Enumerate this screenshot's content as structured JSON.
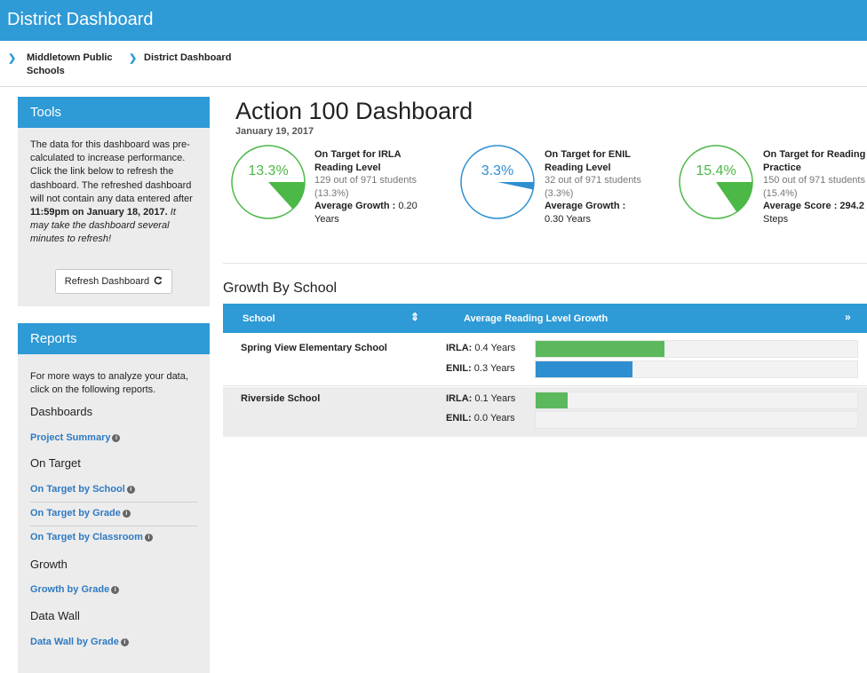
{
  "app_title": "District Dashboard",
  "breadcrumb": {
    "items": [
      {
        "line1": "Middletown Public",
        "line2": "Schools"
      },
      {
        "line1": "District Dashboard",
        "line2": ""
      }
    ]
  },
  "tools": {
    "title": "Tools",
    "text_line1": "The data for this dashboard was pre-",
    "text_line2": "calculated to increase performance.",
    "text_line3": "Click the link below to refresh the",
    "text_line4": "dashboard. The refreshed dashboard",
    "text_line5": "will not contain any data entered after",
    "text_bold": "11:59pm on January 18, 2017.",
    "text_italic_a": " It",
    "text_italic_b": "may take the dashboard several",
    "text_italic_c": "minutes to refresh!",
    "refresh_label": "Refresh Dashboard",
    "refresh_icon": "refresh-icon"
  },
  "reports": {
    "title": "Reports",
    "intro_line1": "For more ways to analyze your data,",
    "intro_line2": "click on the following reports.",
    "groups": [
      {
        "heading": "Dashboards",
        "links": [
          "Project Summary"
        ]
      },
      {
        "heading": "On Target",
        "links": [
          "On Target by School",
          "On Target by Grade",
          "On Target by Classroom"
        ]
      },
      {
        "heading": "Growth",
        "links": [
          "Growth by Grade"
        ]
      },
      {
        "heading": "Data Wall",
        "links": [
          "Data Wall by Grade"
        ]
      }
    ]
  },
  "main": {
    "title": "Action 100 Dashboard",
    "date": "January 19, 2017"
  },
  "stats": [
    {
      "pct_label": "13.3%",
      "fraction": 0.133,
      "color": "#4cb847",
      "title_line1": "On Target for IRLA",
      "title_line2": "Reading Level",
      "detail_line1": "129 out of 971 students",
      "detail_line2": "(13.3%)",
      "metric_label": "Average Growth :",
      "metric_value": " 0.20",
      "metric_line2": "Years"
    },
    {
      "pct_label": "3.3%",
      "fraction": 0.033,
      "color": "#2e8fd0",
      "title_line1": "On Target for ENIL",
      "title_line2": "Reading Level",
      "detail_line1": "32 out of 971 students",
      "detail_line2": "(3.3%)",
      "metric_label": "Average Growth :",
      "metric_value": "",
      "metric_line2": "0.30 Years"
    },
    {
      "pct_label": "15.4%",
      "fraction": 0.154,
      "color": "#4cb847",
      "title_line1": "On Target for Reading",
      "title_line2": "Practice",
      "detail_line1": "150 out of 971 students",
      "detail_line2": "(15.4%)",
      "metric_label": "Average Score :",
      "metric_value": " 294.2",
      "metric_line2": "Steps"
    }
  ],
  "growth": {
    "title": "Growth By School",
    "col_school": "School",
    "col_growth": "Average Reading Level Growth",
    "sort_icon": "sort-icon",
    "expand_icon": "double-chevron-down-icon",
    "colors": {
      "irla": "#5cb85c",
      "enil": "#2e8fd0"
    },
    "rows": [
      {
        "school": "Spring View Elementary School",
        "bars": [
          {
            "label": "IRLA:",
            "value": " 0.4 Years",
            "level": 0.4,
            "type": "irla"
          },
          {
            "label": "ENIL:",
            "value": " 0.3 Years",
            "level": 0.3,
            "type": "enil"
          }
        ]
      },
      {
        "school": "Riverside School",
        "bars": [
          {
            "label": "IRLA:",
            "value": " 0.1 Years",
            "level": 0.1,
            "type": "irla"
          },
          {
            "label": "ENIL:",
            "value": " 0.0 Years",
            "level": 0.0,
            "type": "enil"
          }
        ]
      }
    ]
  }
}
